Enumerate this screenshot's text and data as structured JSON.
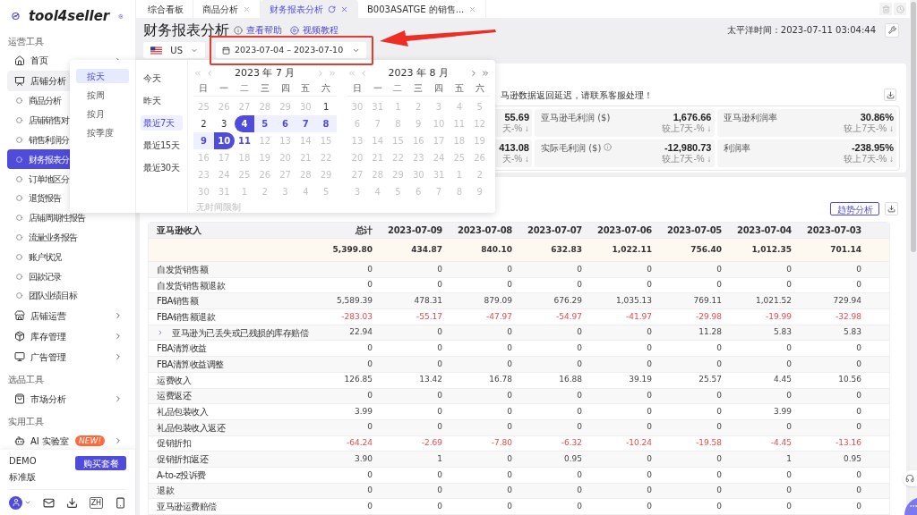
{
  "sidebar": {
    "brand": "tool4seller",
    "sections": [
      {
        "heading": "运营工具",
        "items": [
          {
            "label": "首页",
            "kind": "group",
            "expanded": false
          },
          {
            "label": "店铺分析",
            "kind": "group",
            "expanded": true
          },
          {
            "label": "商品分析",
            "kind": "sub",
            "selected": false
          },
          {
            "label": "店铺销售对",
            "kind": "sub",
            "selected": false
          },
          {
            "label": "销售利润分",
            "kind": "sub",
            "selected": false
          },
          {
            "label": "财务报表分",
            "kind": "sub",
            "selected": true
          },
          {
            "label": "订单地区分",
            "kind": "sub",
            "selected": false
          },
          {
            "label": "退货报告",
            "kind": "sub",
            "selected": false
          },
          {
            "label": "店铺周期性报告",
            "kind": "sub",
            "selected": false
          },
          {
            "label": "流量业务报告",
            "kind": "sub",
            "selected": false
          },
          {
            "label": "账户状况",
            "kind": "sub",
            "selected": false
          },
          {
            "label": "回款记录",
            "kind": "sub",
            "selected": false
          },
          {
            "label": "团队业绩目标",
            "kind": "sub",
            "selected": false
          },
          {
            "label": "店铺运营",
            "kind": "group",
            "expanded": false
          },
          {
            "label": "库存管理",
            "kind": "group",
            "expanded": false
          },
          {
            "label": "广告管理",
            "kind": "group",
            "expanded": false
          }
        ]
      },
      {
        "heading": "选品工具",
        "items": [
          {
            "label": "市场分析",
            "kind": "group",
            "expanded": false
          }
        ]
      },
      {
        "heading": "实用工具",
        "items": [
          {
            "label": "AI 实验室",
            "kind": "group",
            "expanded": false,
            "badge": "NEW!"
          }
        ]
      }
    ],
    "account": {
      "name": "DEMO",
      "plan": "标准版",
      "button": "购买套餐"
    },
    "language": "ZH"
  },
  "tabs": [
    {
      "label": "综合看板",
      "selected": false,
      "closable": false,
      "refresh": false
    },
    {
      "label": "商品分析",
      "selected": false,
      "closable": true,
      "refresh": false
    },
    {
      "label": "财务报表分析",
      "selected": true,
      "closable": true,
      "refresh": true
    },
    {
      "label": "B003ASATGE 的销售...",
      "selected": false,
      "closable": true,
      "refresh": false
    }
  ],
  "page": {
    "title": "财务报表分析",
    "help": "查看帮助",
    "video": "视频教程",
    "timezone": "太平洋时间：2023-07-11 03:04:44",
    "country": "US",
    "date_range": "2023-07-04 – 2023-07-10"
  },
  "notice": "马逊数据返回延迟，请联系客服处理！",
  "stats": [
    {
      "value": "55.69",
      "compare": "天-% ↓"
    },
    {
      "label": "亚马逊毛利润 ($)",
      "value": "1,676.66",
      "compare": "较上7天-% ↓",
      "info": false
    },
    {
      "label": "亚马逊利润率",
      "value": "30.86%",
      "compare": "较上7天-% ↓",
      "info": false
    },
    {
      "value": "413.08",
      "compare": "天-% ↓"
    },
    {
      "label": "实际毛利润 ($)",
      "value": "-12,980.73",
      "compare": "较上7天-% ↓",
      "info": true
    },
    {
      "label": "利润率",
      "value": "-238.95%",
      "compare": "较上7天-% ↓",
      "info": false
    }
  ],
  "trend_button": "趋势分析",
  "table": {
    "columns": [
      "亚马逊收入",
      "总计",
      "2023-07-09",
      "2023-07-08",
      "2023-07-07",
      "2023-07-06",
      "2023-07-05",
      "2023-07-04",
      "2023-07-03"
    ],
    "rows": [
      {
        "kind": "total",
        "label": "",
        "negative": false,
        "expandable": false,
        "values": [
          "5,399.80",
          "434.87",
          "840.10",
          "632.83",
          "1,022.11",
          "756.40",
          "1,012.35",
          "701.14"
        ]
      },
      {
        "kind": "row",
        "label": "自发货销售额",
        "negative": false,
        "expandable": false,
        "values": [
          "0",
          "0",
          "0",
          "0",
          "0",
          "0",
          "0",
          "0"
        ]
      },
      {
        "kind": "row",
        "label": "自发货销售额退款",
        "negative": false,
        "expandable": false,
        "values": [
          "0",
          "0",
          "0",
          "0",
          "0",
          "0",
          "0",
          "0"
        ]
      },
      {
        "kind": "row",
        "label": "FBA销售额",
        "negative": false,
        "expandable": false,
        "values": [
          "5,589.39",
          "478.31",
          "879.09",
          "676.29",
          "1,035.13",
          "769.11",
          "1,021.52",
          "729.94"
        ]
      },
      {
        "kind": "row",
        "label": "FBA销售额退款",
        "negative": true,
        "expandable": false,
        "values": [
          "-283.03",
          "-55.17",
          "-47.97",
          "-54.97",
          "-41.97",
          "-29.98",
          "-19.99",
          "-32.98"
        ]
      },
      {
        "kind": "row",
        "label": "亚马逊为已丢失或已残损的库存赔偿",
        "negative": false,
        "expandable": true,
        "values": [
          "22.94",
          "0",
          "0",
          "0",
          "0",
          "11.28",
          "5.83",
          "5.83"
        ]
      },
      {
        "kind": "row",
        "label": "FBA清算收益",
        "negative": false,
        "expandable": false,
        "values": [
          "0",
          "0",
          "0",
          "0",
          "0",
          "0",
          "0",
          "0"
        ]
      },
      {
        "kind": "row",
        "label": "FBA清算收益调整",
        "negative": false,
        "expandable": false,
        "values": [
          "0",
          "0",
          "0",
          "0",
          "0",
          "0",
          "0",
          "0"
        ]
      },
      {
        "kind": "row",
        "label": "运费收入",
        "negative": false,
        "expandable": false,
        "values": [
          "126.85",
          "13.42",
          "16.78",
          "16.88",
          "39.19",
          "25.57",
          "4.45",
          "10.56"
        ]
      },
      {
        "kind": "row",
        "label": "运费返还",
        "negative": false,
        "expandable": false,
        "values": [
          "0",
          "0",
          "0",
          "0",
          "0",
          "0",
          "0",
          "0"
        ]
      },
      {
        "kind": "row",
        "label": "礼品包装收入",
        "negative": false,
        "expandable": false,
        "values": [
          "3.99",
          "0",
          "0",
          "0",
          "0",
          "0",
          "3.99",
          "0"
        ]
      },
      {
        "kind": "row",
        "label": "礼品包装收入返还",
        "negative": false,
        "expandable": false,
        "values": [
          "0",
          "0",
          "0",
          "0",
          "0",
          "0",
          "0",
          "0"
        ]
      },
      {
        "kind": "row",
        "label": "促销折扣",
        "negative": true,
        "expandable": false,
        "values": [
          "-64.24",
          "-2.69",
          "-7.80",
          "-6.32",
          "-10.24",
          "-19.58",
          "-4.45",
          "-13.16"
        ]
      },
      {
        "kind": "row",
        "label": "促销折扣返还",
        "negative": false,
        "expandable": false,
        "values": [
          "3.90",
          "1",
          "0",
          "0.95",
          "0",
          "0",
          "1",
          "0.95"
        ]
      },
      {
        "kind": "row",
        "label": "A-to-z投诉费",
        "negative": false,
        "expandable": false,
        "values": [
          "0",
          "0",
          "0",
          "0",
          "0",
          "0",
          "0",
          "0"
        ]
      },
      {
        "kind": "row",
        "label": "退款",
        "negative": false,
        "expandable": false,
        "values": [
          "0",
          "0",
          "0",
          "0",
          "0",
          "0",
          "0",
          "0"
        ]
      },
      {
        "kind": "row",
        "label": "亚马逊运费赔偿",
        "negative": false,
        "expandable": false,
        "values": [
          "0",
          "0",
          "0",
          "0",
          "0",
          "0",
          "0",
          "0"
        ]
      }
    ]
  },
  "date_picker": {
    "units": [
      {
        "label": "按天",
        "selected": true
      },
      {
        "label": "按周",
        "selected": false
      },
      {
        "label": "按月",
        "selected": false
      },
      {
        "label": "按季度",
        "selected": false
      }
    ],
    "presets": [
      {
        "label": "今天",
        "selected": false
      },
      {
        "label": "昨天",
        "selected": false
      },
      {
        "label": "最近7天",
        "selected": true
      },
      {
        "label": "最近15天",
        "selected": false
      },
      {
        "label": "最近30天",
        "selected": false
      }
    ],
    "no_limit": "无时间限制",
    "months": [
      {
        "title": "2023 年 7 月",
        "weekdays": [
          "日",
          "一",
          "二",
          "三",
          "四",
          "五",
          "六"
        ],
        "days": [
          {
            "d": "25",
            "kind": "muted"
          },
          {
            "d": "26",
            "kind": "muted"
          },
          {
            "d": "27",
            "kind": "muted"
          },
          {
            "d": "28",
            "kind": "muted"
          },
          {
            "d": "29",
            "kind": "muted"
          },
          {
            "d": "30",
            "kind": "muted"
          },
          {
            "d": "1",
            "kind": "normal"
          },
          {
            "d": "2",
            "kind": "normal"
          },
          {
            "d": "3",
            "kind": "normal"
          },
          {
            "d": "4",
            "kind": "start"
          },
          {
            "d": "5",
            "kind": "range"
          },
          {
            "d": "6",
            "kind": "range"
          },
          {
            "d": "7",
            "kind": "range"
          },
          {
            "d": "8",
            "kind": "range"
          },
          {
            "d": "9",
            "kind": "range"
          },
          {
            "d": "10",
            "kind": "end"
          },
          {
            "d": "11",
            "kind": "today"
          },
          {
            "d": "12",
            "kind": "muted"
          },
          {
            "d": "13",
            "kind": "muted"
          },
          {
            "d": "14",
            "kind": "muted"
          },
          {
            "d": "15",
            "kind": "muted"
          },
          {
            "d": "16",
            "kind": "muted"
          },
          {
            "d": "17",
            "kind": "muted"
          },
          {
            "d": "18",
            "kind": "muted"
          },
          {
            "d": "19",
            "kind": "muted"
          },
          {
            "d": "20",
            "kind": "muted"
          },
          {
            "d": "21",
            "kind": "muted"
          },
          {
            "d": "22",
            "kind": "muted"
          },
          {
            "d": "23",
            "kind": "muted"
          },
          {
            "d": "24",
            "kind": "muted"
          },
          {
            "d": "25",
            "kind": "muted"
          },
          {
            "d": "26",
            "kind": "muted"
          },
          {
            "d": "27",
            "kind": "muted"
          },
          {
            "d": "28",
            "kind": "muted"
          },
          {
            "d": "29",
            "kind": "muted"
          },
          {
            "d": "30",
            "kind": "muted"
          },
          {
            "d": "31",
            "kind": "muted"
          },
          {
            "d": "1",
            "kind": "muted"
          },
          {
            "d": "2",
            "kind": "muted"
          },
          {
            "d": "3",
            "kind": "muted"
          },
          {
            "d": "4",
            "kind": "muted"
          },
          {
            "d": "5",
            "kind": "muted"
          }
        ]
      },
      {
        "title": "2023 年 8 月",
        "weekdays": [
          "日",
          "一",
          "二",
          "三",
          "四",
          "五",
          "六"
        ],
        "days": [
          {
            "d": "30",
            "kind": "muted"
          },
          {
            "d": "31",
            "kind": "muted"
          },
          {
            "d": "1",
            "kind": "muted"
          },
          {
            "d": "2",
            "kind": "muted"
          },
          {
            "d": "3",
            "kind": "muted"
          },
          {
            "d": "4",
            "kind": "muted"
          },
          {
            "d": "5",
            "kind": "muted"
          },
          {
            "d": "6",
            "kind": "muted"
          },
          {
            "d": "7",
            "kind": "muted"
          },
          {
            "d": "8",
            "kind": "muted"
          },
          {
            "d": "9",
            "kind": "muted"
          },
          {
            "d": "10",
            "kind": "muted"
          },
          {
            "d": "11",
            "kind": "muted"
          },
          {
            "d": "12",
            "kind": "muted"
          },
          {
            "d": "13",
            "kind": "muted"
          },
          {
            "d": "14",
            "kind": "muted"
          },
          {
            "d": "15",
            "kind": "muted"
          },
          {
            "d": "16",
            "kind": "muted"
          },
          {
            "d": "17",
            "kind": "muted"
          },
          {
            "d": "18",
            "kind": "muted"
          },
          {
            "d": "19",
            "kind": "muted"
          },
          {
            "d": "20",
            "kind": "muted"
          },
          {
            "d": "21",
            "kind": "muted"
          },
          {
            "d": "22",
            "kind": "muted"
          },
          {
            "d": "23",
            "kind": "muted"
          },
          {
            "d": "24",
            "kind": "muted"
          },
          {
            "d": "25",
            "kind": "muted"
          },
          {
            "d": "26",
            "kind": "muted"
          },
          {
            "d": "27",
            "kind": "muted"
          },
          {
            "d": "28",
            "kind": "muted"
          },
          {
            "d": "29",
            "kind": "muted"
          },
          {
            "d": "30",
            "kind": "muted"
          },
          {
            "d": "31",
            "kind": "muted"
          },
          {
            "d": "1",
            "kind": "muted"
          },
          {
            "d": "2",
            "kind": "muted"
          },
          {
            "d": "3",
            "kind": "muted"
          },
          {
            "d": "4",
            "kind": "muted"
          },
          {
            "d": "5",
            "kind": "muted"
          },
          {
            "d": "6",
            "kind": "muted"
          },
          {
            "d": "7",
            "kind": "muted"
          },
          {
            "d": "8",
            "kind": "muted"
          },
          {
            "d": "9",
            "kind": "muted"
          }
        ]
      }
    ]
  }
}
